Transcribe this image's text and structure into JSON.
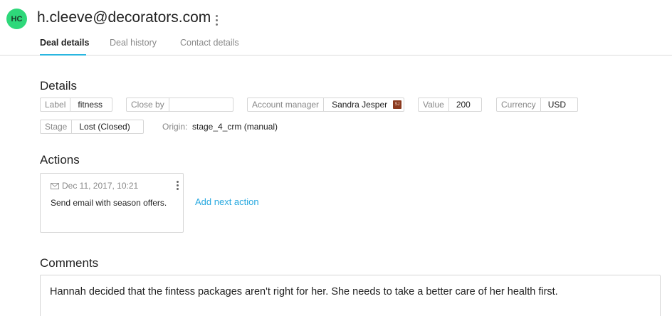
{
  "header": {
    "avatar_initials": "HC",
    "avatar_color": "#2ed87a",
    "email": "h.cleeve@decorators.com",
    "more_icon": "vertical-dots-icon"
  },
  "tabs": [
    {
      "label": "Deal details",
      "active": true
    },
    {
      "label": "Deal history",
      "active": false
    },
    {
      "label": "Contact details",
      "active": false
    }
  ],
  "accent_color": "#29b6e0",
  "details": {
    "title": "Details",
    "fields": {
      "label": {
        "label": "Label",
        "value": "fitness"
      },
      "close_by": {
        "label": "Close by",
        "value": ""
      },
      "account_manager": {
        "label": "Account manager",
        "value": "Sandra Jesper",
        "badge": "SJ"
      },
      "value": {
        "label": "Value",
        "value": "200"
      },
      "currency": {
        "label": "Currency",
        "value": "USD"
      },
      "stage": {
        "label": "Stage",
        "value": "Lost (Closed)"
      }
    },
    "origin": {
      "label": "Origin:",
      "value": "stage_4_crm (manual)"
    }
  },
  "actions": {
    "title": "Actions",
    "items": [
      {
        "icon": "mail-icon",
        "date": "Dec 11, 2017, 10:21",
        "text": "Send email with season offers."
      }
    ],
    "add_label": "Add next action"
  },
  "comments": {
    "title": "Comments",
    "text": "Hannah decided that the fintess packages aren't right for her. She needs to take a better care of her health first."
  }
}
